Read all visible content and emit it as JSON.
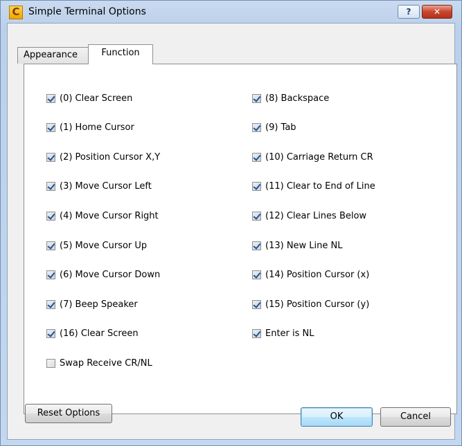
{
  "window": {
    "title": "Simple Terminal Options",
    "app_icon_glyph": "C",
    "help_glyph": "?",
    "close_glyph": "✕"
  },
  "tabs": [
    {
      "label": "Appearance",
      "active": false
    },
    {
      "label": "Function",
      "active": true
    }
  ],
  "left_options": [
    {
      "label": "(0) Clear Screen",
      "checked": true
    },
    {
      "label": "(1) Home Cursor",
      "checked": true
    },
    {
      "label": "(2) Position Cursor X,Y",
      "checked": true
    },
    {
      "label": "(3) Move Cursor Left",
      "checked": true
    },
    {
      "label": "(4) Move Cursor Right",
      "checked": true
    },
    {
      "label": "(5) Move Cursor Up",
      "checked": true
    },
    {
      "label": "(6) Move Cursor Down",
      "checked": true
    },
    {
      "label": "(7) Beep Speaker",
      "checked": true
    },
    {
      "label": "(16) Clear Screen",
      "checked": true
    },
    {
      "label": "Swap Receive CR/NL",
      "checked": false
    }
  ],
  "right_options": [
    {
      "label": "(8) Backspace",
      "checked": true
    },
    {
      "label": "(9) Tab",
      "checked": true
    },
    {
      "label": "(10) Carriage Return CR",
      "checked": true
    },
    {
      "label": "(11) Clear to End of Line",
      "checked": true
    },
    {
      "label": "(12) Clear Lines Below",
      "checked": true
    },
    {
      "label": "(13) New Line NL",
      "checked": true
    },
    {
      "label": "(14) Position Cursor (x)",
      "checked": true
    },
    {
      "label": "(15) Position Cursor (y)",
      "checked": true
    },
    {
      "label": "Enter is NL",
      "checked": true
    }
  ],
  "buttons": {
    "reset": "Reset Options",
    "ok": "OK",
    "cancel": "Cancel"
  }
}
